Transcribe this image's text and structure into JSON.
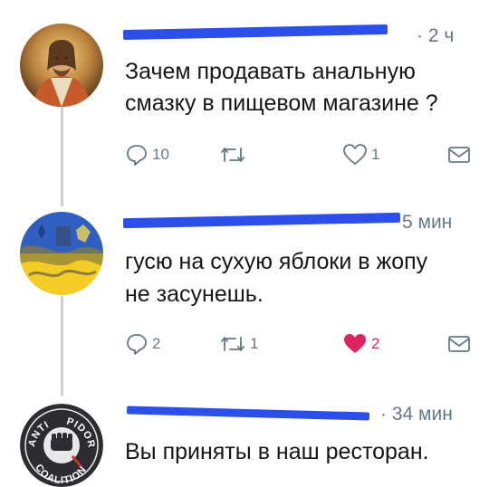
{
  "tweets": [
    {
      "timestamp": "· 2 ч",
      "text_lines": [
        "Зачем продавать анальную",
        "смазку в пищевом магазине ?"
      ],
      "reply_count": "10",
      "retweet_count": "",
      "like_count": "1",
      "liked": false,
      "avatar_icon": "saint-portrait-icon"
    },
    {
      "timestamp": "5 мин",
      "text_lines": [
        "гусю на сухую яблоки в жопу",
        "не засунешь."
      ],
      "reply_count": "2",
      "retweet_count": "1",
      "like_count": "2",
      "liked": true,
      "avatar_icon": "flag-collage-icon"
    },
    {
      "timestamp": "· 34 мин",
      "text_lines": [
        "Вы приняты в наш ресторан."
      ],
      "avatar_icon": "anti-pidor-coalition-emblem-icon",
      "avatar_emblem_text": [
        "ANTI",
        "PIDOR",
        "COALITION"
      ]
    }
  ],
  "colors": {
    "redaction": "#2b4fe8",
    "text": "#14171a",
    "muted": "#657786",
    "like": "#e0245e",
    "thread_line": "#c9d1d9"
  }
}
